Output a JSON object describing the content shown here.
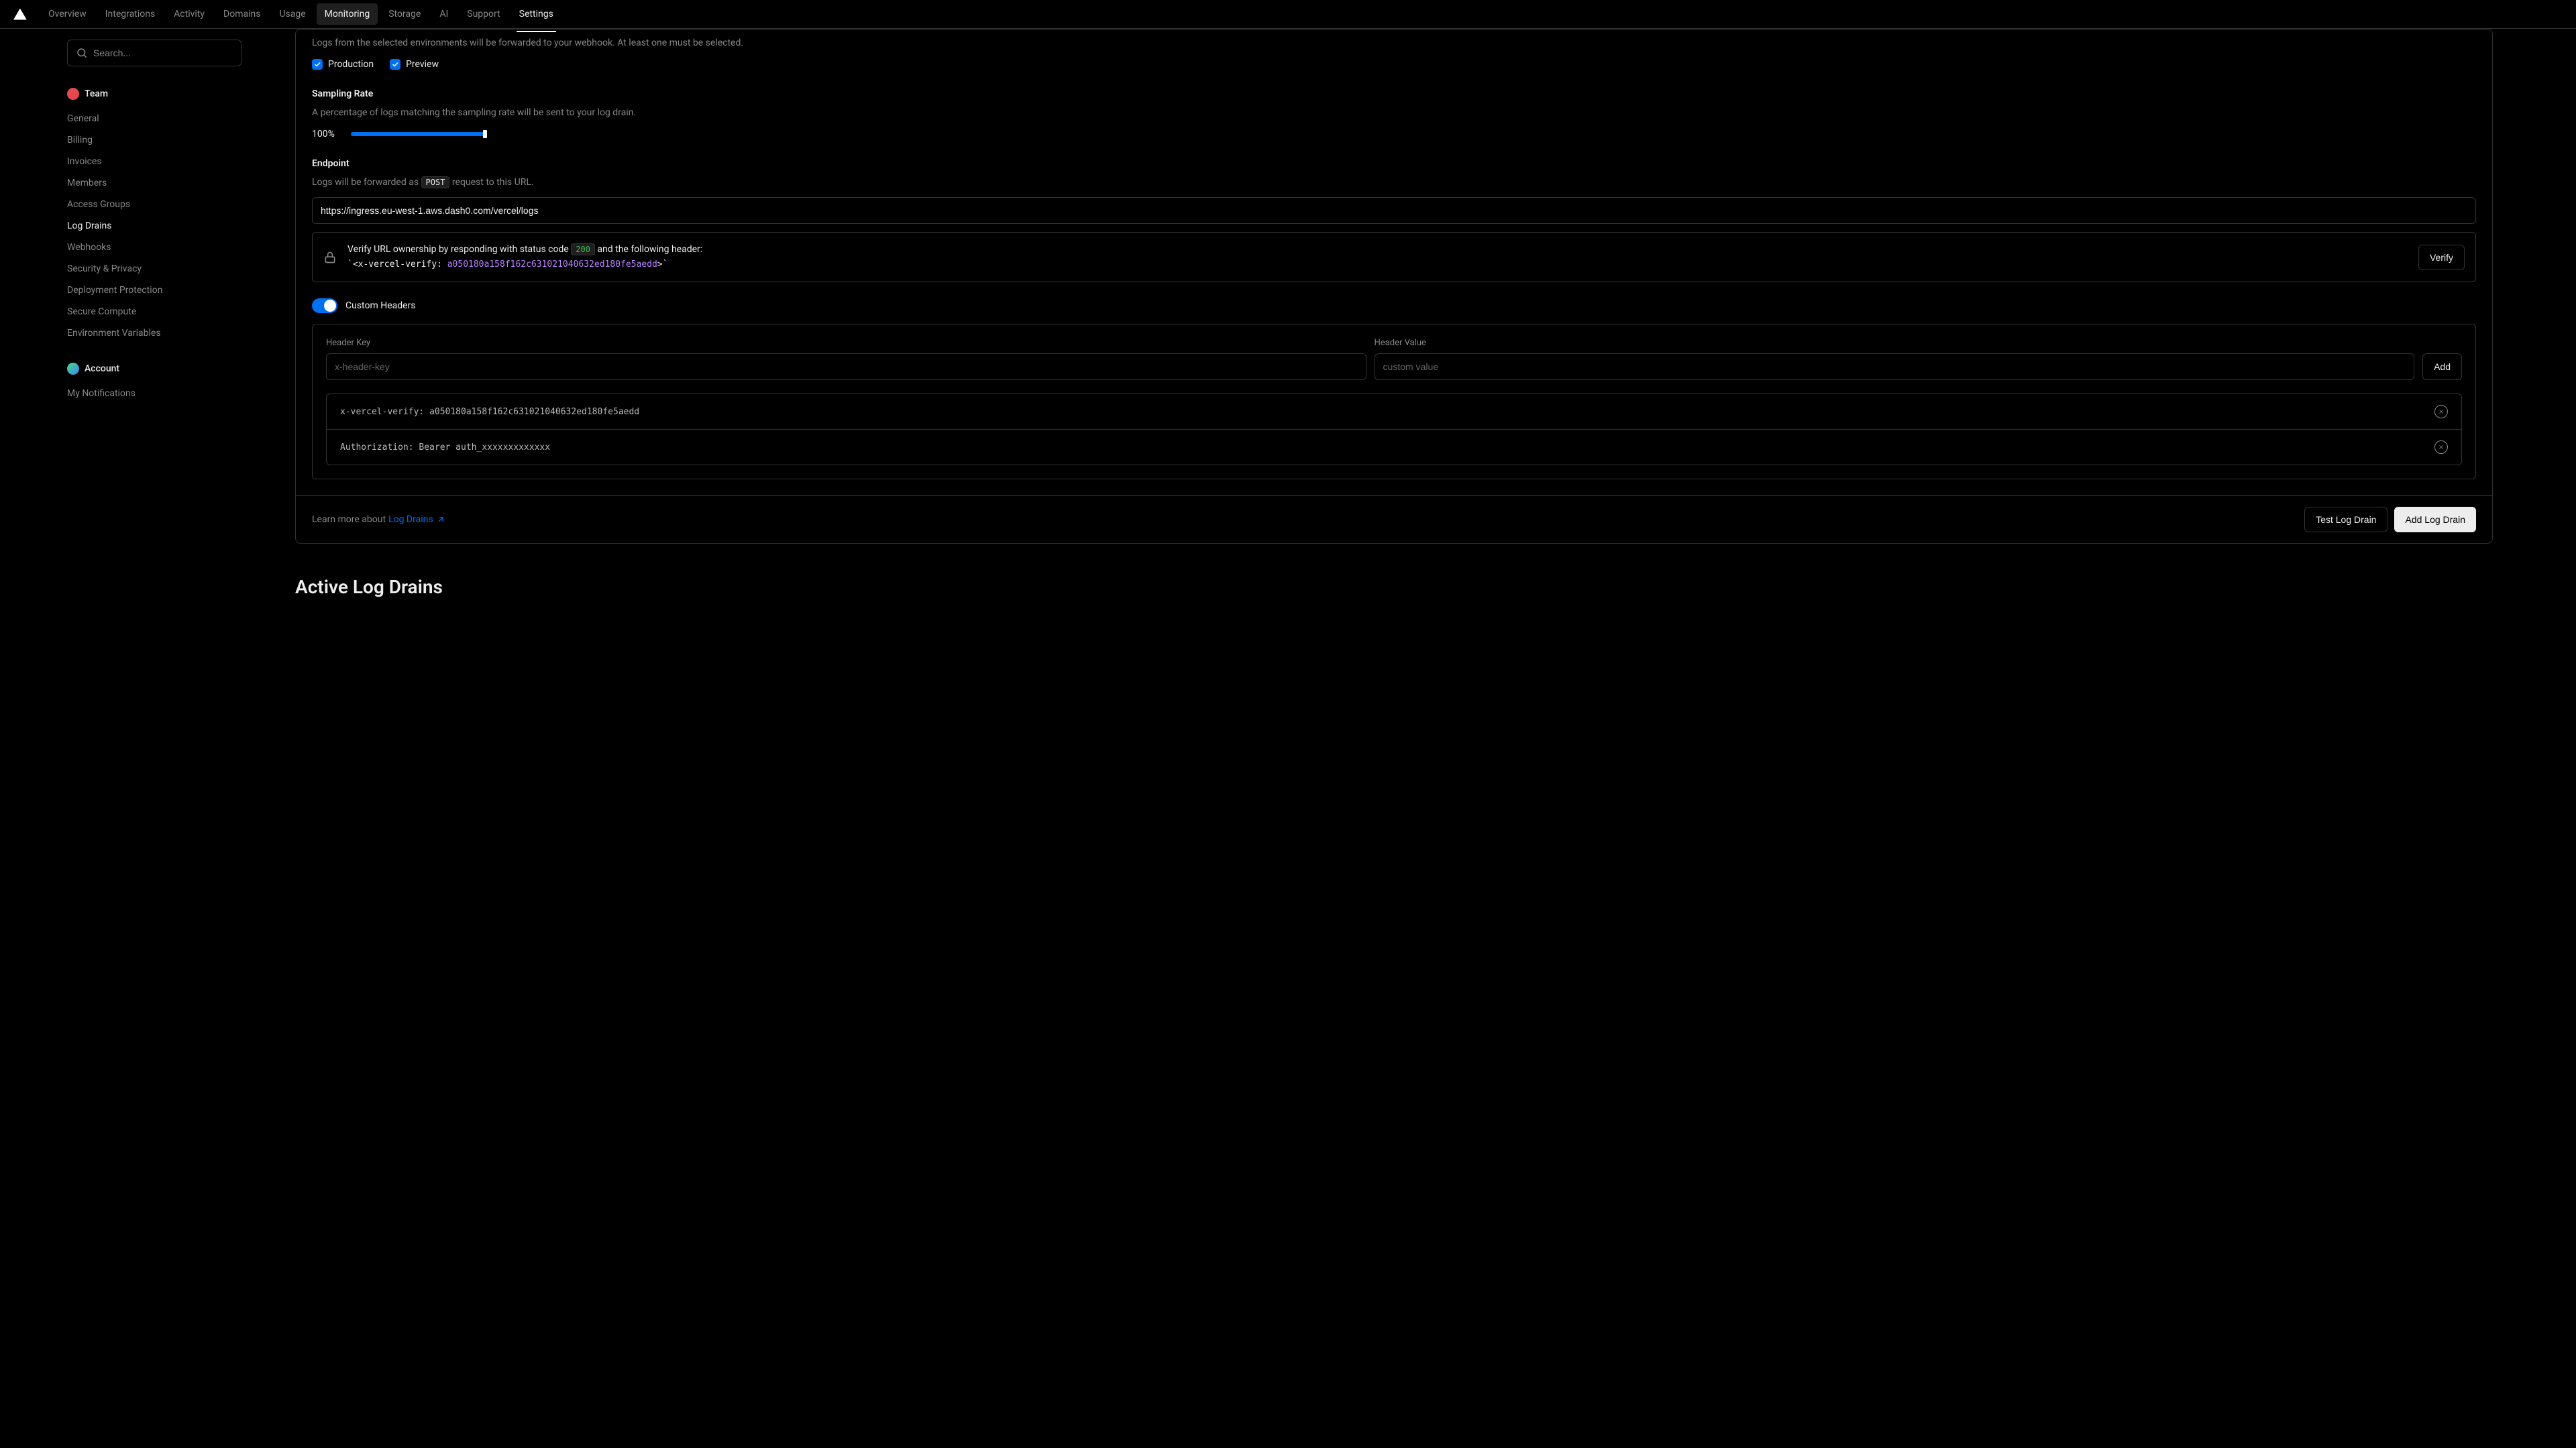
{
  "nav": {
    "items": [
      "Overview",
      "Integrations",
      "Activity",
      "Domains",
      "Usage",
      "Monitoring",
      "Storage",
      "AI",
      "Support",
      "Settings"
    ],
    "pill_index": 5,
    "active_index": 9
  },
  "sidebar": {
    "search_placeholder": "Search...",
    "team_label": "Team",
    "team_items": [
      "General",
      "Billing",
      "Invoices",
      "Members",
      "Access Groups",
      "Log Drains",
      "Webhooks",
      "Security & Privacy",
      "Deployment Protection",
      "Secure Compute",
      "Environment Variables"
    ],
    "team_active_index": 5,
    "account_label": "Account",
    "account_items": [
      "My Notifications"
    ]
  },
  "env": {
    "desc": "Logs from the selected environments will be forwarded to your webhook. At least one must be selected.",
    "production": "Production",
    "preview": "Preview",
    "production_checked": true,
    "preview_checked": true
  },
  "sampling": {
    "title": "Sampling Rate",
    "desc": "A percentage of logs matching the sampling rate will be sent to your log drain.",
    "value": "100%",
    "percent": 100
  },
  "endpoint": {
    "title": "Endpoint",
    "desc_prefix": "Logs will be forwarded as ",
    "method": "POST",
    "desc_suffix": " request to this URL.",
    "url": "https://ingress.eu-west-1.aws.dash0.com/vercel/logs"
  },
  "verify": {
    "text_prefix": "Verify URL ownership by responding with status code ",
    "ok_code": "200",
    "text_mid": " and the following header:",
    "header_prefix": "<x-vercel-verify: ",
    "token": "a050180a158f162c631021040632ed180fe5aedd",
    "header_suffix": ">",
    "button": "Verify"
  },
  "custom_headers": {
    "label": "Custom Headers",
    "enabled": true,
    "key_label": "Header Key",
    "value_label": "Header Value",
    "key_placeholder": "x-header-key",
    "value_placeholder": "custom value",
    "add_button": "Add",
    "rows": [
      "x-vercel-verify: a050180a158f162c631021040632ed180fe5aedd",
      "Authorization: Bearer auth_xxxxxxxxxxxxx"
    ]
  },
  "footer": {
    "learn_prefix": "Learn more about ",
    "link_text": "Log Drains",
    "test_button": "Test Log Drain",
    "add_button": "Add Log Drain"
  },
  "active_section_title": "Active Log Drains",
  "chart_data": null
}
